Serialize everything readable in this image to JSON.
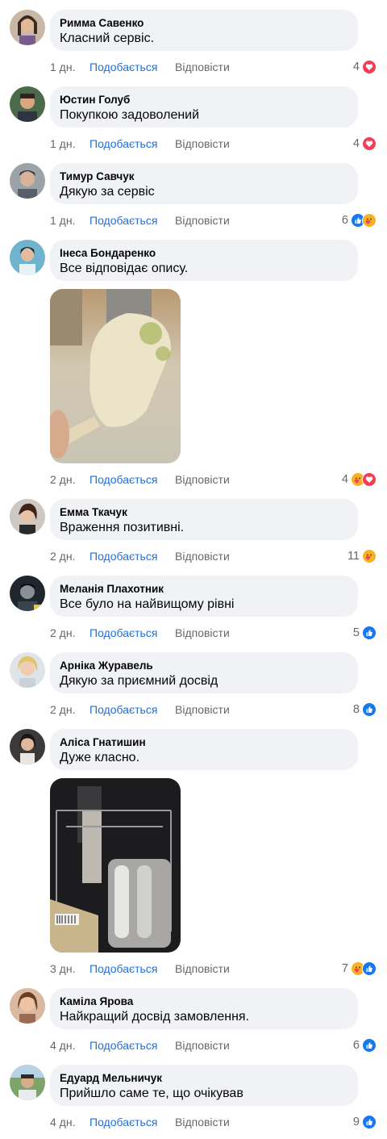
{
  "actions": {
    "like_label": "Подобається",
    "reply_label": "Відповісти"
  },
  "colors": {
    "like_blue": "#216fdb",
    "love_red": "#f33e58",
    "care_yellow": "#f7b125",
    "bubble_bg": "#f0f2f5",
    "meta_gray": "#65676b"
  },
  "comments": [
    {
      "author": "Римма Савенко",
      "text": "Класний сервіс.",
      "time": "1 дн.",
      "count": "4",
      "reactions": [
        "love-icon"
      ]
    },
    {
      "author": "Юстин Голуб",
      "text": "Покупкою задоволений",
      "time": "1 дн.",
      "count": "4",
      "reactions": [
        "love-icon"
      ]
    },
    {
      "author": "Тимур Савчук",
      "text": "Дякую за сервіс",
      "time": "1 дн.",
      "count": "6",
      "reactions": [
        "like-icon",
        "care-icon"
      ]
    },
    {
      "author": "Інеса Бондаренко",
      "text": "Все відповідає опису.",
      "time": "2 дн.",
      "count": "4",
      "reactions": [
        "care-icon",
        "love-icon"
      ],
      "photo": "popsicle-photo"
    },
    {
      "author": "Емма Ткачук",
      "text": "Враження позитивні.",
      "time": "2 дн.",
      "count": "11",
      "reactions": [
        "care-icon"
      ]
    },
    {
      "author": "Меланія Плахотник",
      "text": "Все було на найвищому рівні",
      "time": "2 дн.",
      "count": "5",
      "reactions": [
        "like-icon"
      ]
    },
    {
      "author": "Арніка Журавель",
      "text": "Дякую за приємний досвід",
      "time": "2 дн.",
      "count": "8",
      "reactions": [
        "like-icon"
      ]
    },
    {
      "author": "Аліса Гнатишин",
      "text": "Дуже класно.",
      "time": "3 дн.",
      "count": "7",
      "reactions": [
        "care-icon",
        "like-icon"
      ],
      "photo": "mold-photo"
    },
    {
      "author": "Каміла Ярова",
      "text": "Найкращий досвід замовлення.",
      "time": "4 дн.",
      "count": "6",
      "reactions": [
        "like-icon"
      ]
    },
    {
      "author": "Едуард Мельничук",
      "text": "Прийшло саме те, що очікував",
      "time": "4 дн.",
      "count": "9",
      "reactions": [
        "like-icon"
      ]
    }
  ]
}
